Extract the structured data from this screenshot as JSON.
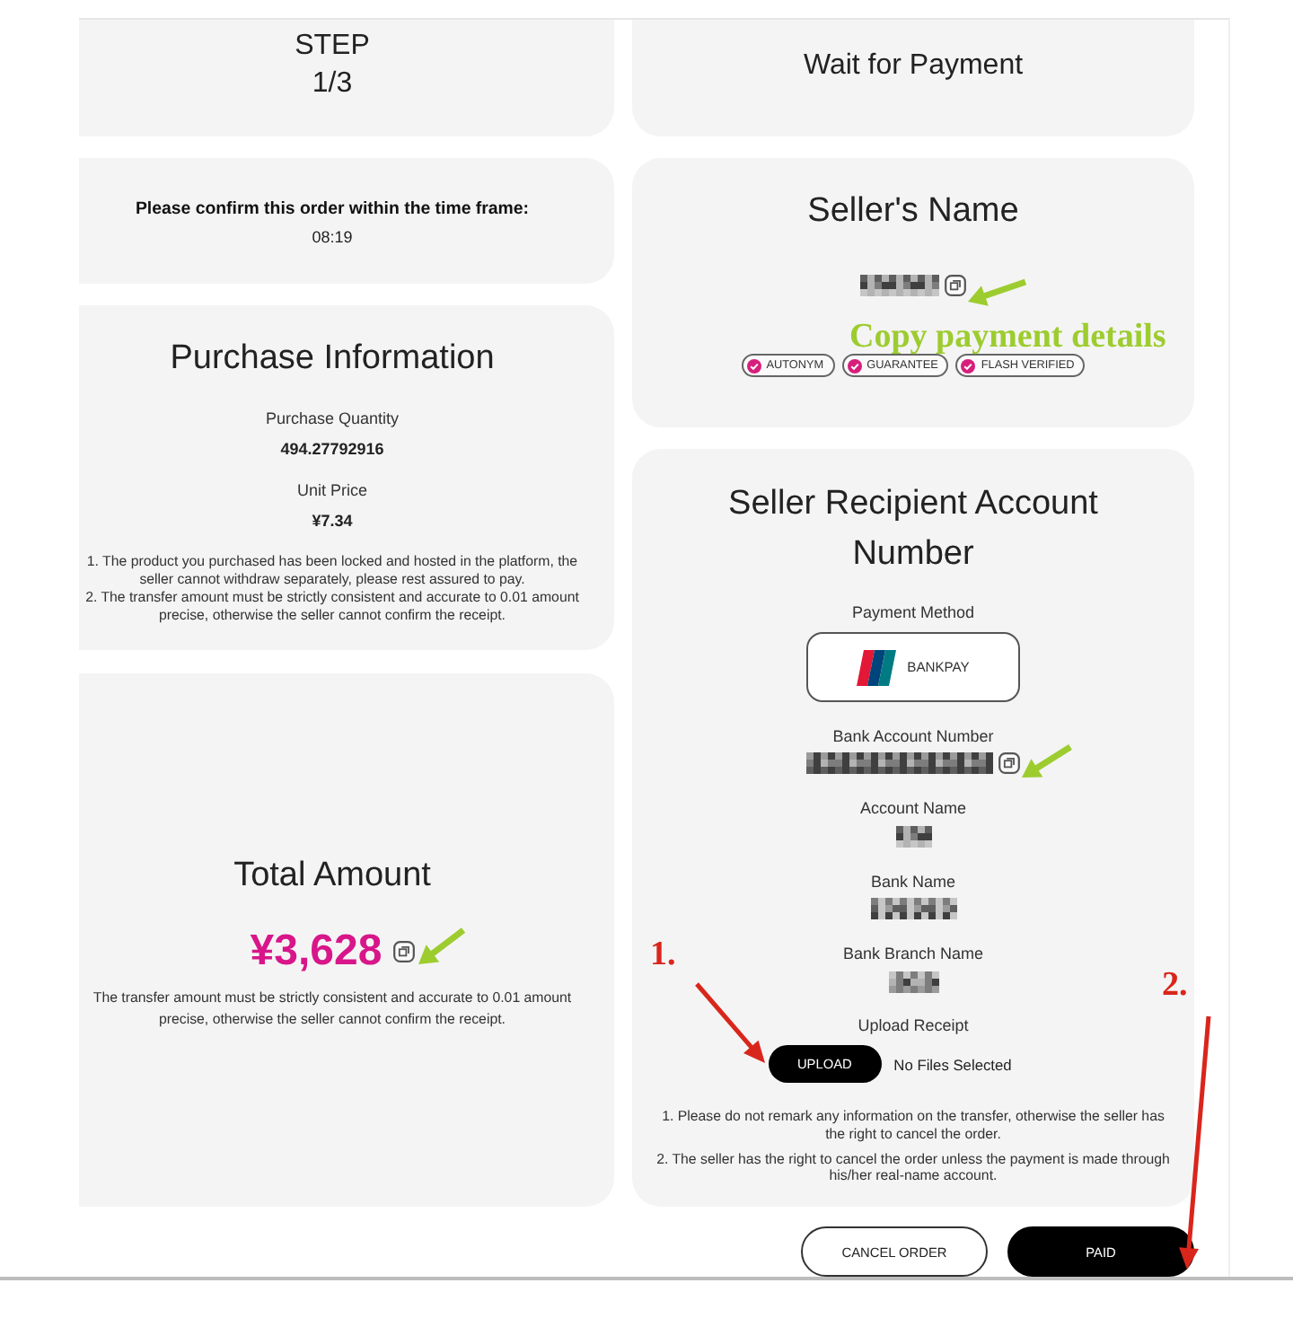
{
  "step_card": {
    "label": "STEP",
    "count": "1/3"
  },
  "status_card": {
    "title": "Wait for Payment"
  },
  "timer_card": {
    "message": "Please confirm this order within the time frame:",
    "countdown": "08:19"
  },
  "seller_card": {
    "title": "Seller's Name",
    "name_masked": true,
    "copyable": true,
    "badges": [
      "AUTONYM",
      "GUARANTEE",
      "FLASH VERIFIED"
    ]
  },
  "purchase_card": {
    "title": "Purchase Information",
    "fields": [
      {
        "label": "Purchase Quantity",
        "value": "494.27792916"
      },
      {
        "label": "Unit Price",
        "value": "¥7.34"
      }
    ],
    "notes": [
      "1. The product you purchased has been locked and hosted in the platform, the seller cannot withdraw separately, please rest assured to pay.",
      "2. The transfer amount must be strictly consistent and accurate to 0.01 amount precise, otherwise the seller cannot confirm the receipt."
    ]
  },
  "account_card": {
    "title": "Seller Recipient Account Number",
    "payment_method": {
      "label": "Payment Method",
      "name": "BANKPAY"
    },
    "fields": [
      {
        "label": "Bank Account Number",
        "masked": true,
        "copyable": true
      },
      {
        "label": "Account Name",
        "masked": true,
        "copyable": false
      },
      {
        "label": "Bank Name",
        "masked": true,
        "copyable": false
      },
      {
        "label": "Bank Branch Name",
        "masked": true,
        "copyable": false
      }
    ],
    "upload": {
      "label": "Upload Receipt",
      "button": "UPLOAD",
      "status": "No Files Selected"
    },
    "notes": [
      "1. Please do not remark any information on the transfer, otherwise the seller has the right to cancel the order.",
      "2. The seller has the right to cancel the order unless the payment is made through his/her real-name account."
    ]
  },
  "total_card": {
    "title": "Total Amount",
    "amount": "¥3,628",
    "copyable": true,
    "note": "The transfer amount must be strictly consistent and accurate to 0.01 amount precise, otherwise the seller cannot confirm the receipt."
  },
  "actions": [
    {
      "label": "CANCEL ORDER",
      "kind": "outline"
    },
    {
      "label": "PAID",
      "kind": "primary"
    }
  ],
  "annotations": [
    {
      "kind": "arrow",
      "color": "#9dcc2f"
    },
    {
      "kind": "text",
      "text": "Copy payment details",
      "color": "#9dcc2f"
    },
    {
      "kind": "arrow",
      "color": "#9dcc2f"
    },
    {
      "kind": "arrow",
      "color": "#9dcc2f"
    },
    {
      "kind": "text",
      "text": "1.",
      "color": "#d9261c"
    },
    {
      "kind": "arrow",
      "color": "#d9261c"
    },
    {
      "kind": "text",
      "text": "2.",
      "color": "#d9261c"
    },
    {
      "kind": "arrow",
      "color": "#d9261c"
    }
  ]
}
